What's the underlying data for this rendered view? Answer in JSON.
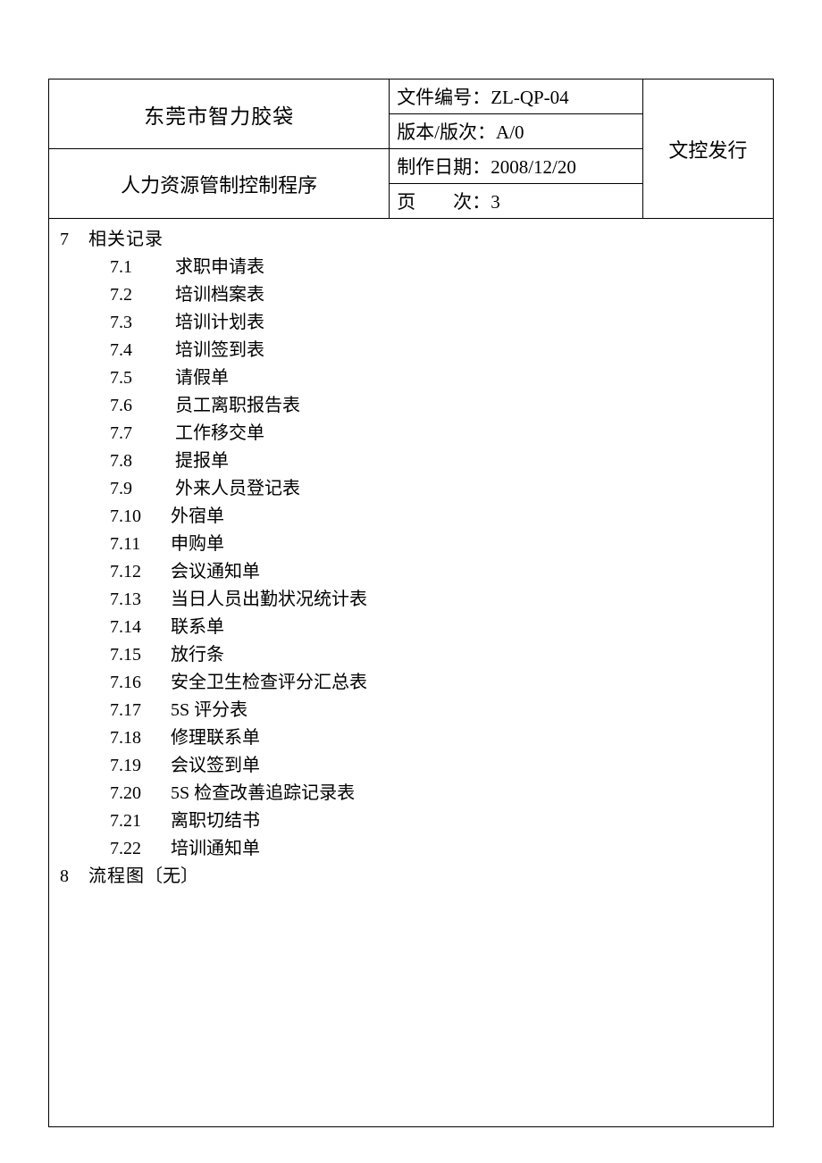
{
  "header": {
    "org": "东莞市智力胶袋",
    "procedure": "人力资源管制控制程序",
    "doc_no_label": "文件编号：",
    "doc_no": "ZL-QP-04",
    "version_label": "版本/版次：",
    "version": "A/0",
    "date_label": "制作日期：",
    "date": "2008/12/20",
    "page_label": "页　　次：",
    "page": "3",
    "issue": "文控发行"
  },
  "section7": {
    "num": "7",
    "title": "相关记录",
    "items": [
      {
        "n": "7.1",
        "t": "求职申请表"
      },
      {
        "n": "7.2",
        "t": "培训档案表"
      },
      {
        "n": "7.3",
        "t": "培训计划表"
      },
      {
        "n": "7.4",
        "t": "培训签到表"
      },
      {
        "n": "7.5",
        "t": "请假单"
      },
      {
        "n": "7.6",
        "t": "员工离职报告表"
      },
      {
        "n": "7.7",
        "t": "工作移交单"
      },
      {
        "n": "7.8",
        "t": "提报单"
      },
      {
        "n": "7.9",
        "t": "外来人员登记表"
      },
      {
        "n": "7.10",
        "t": "外宿单"
      },
      {
        "n": "7.11",
        "t": "申购单"
      },
      {
        "n": "7.12",
        "t": "会议通知单"
      },
      {
        "n": "7.13",
        "t": "当日人员出勤状况统计表"
      },
      {
        "n": "7.14",
        "t": "联系单"
      },
      {
        "n": "7.15",
        "t": "放行条"
      },
      {
        "n": "7.16",
        "t": "安全卫生检查评分汇总表"
      },
      {
        "n": "7.17",
        "t": "5S 评分表"
      },
      {
        "n": "7.18",
        "t": "修理联系单"
      },
      {
        "n": "7.19",
        "t": "会议签到单"
      },
      {
        "n": "7.20",
        "t": "5S 检查改善追踪记录表"
      },
      {
        "n": "7.21",
        "t": "离职切结书"
      },
      {
        "n": "7.22",
        "t": "培训通知单"
      }
    ]
  },
  "section8": {
    "num": "8",
    "title": "流程图",
    "note": "〔无〕"
  }
}
